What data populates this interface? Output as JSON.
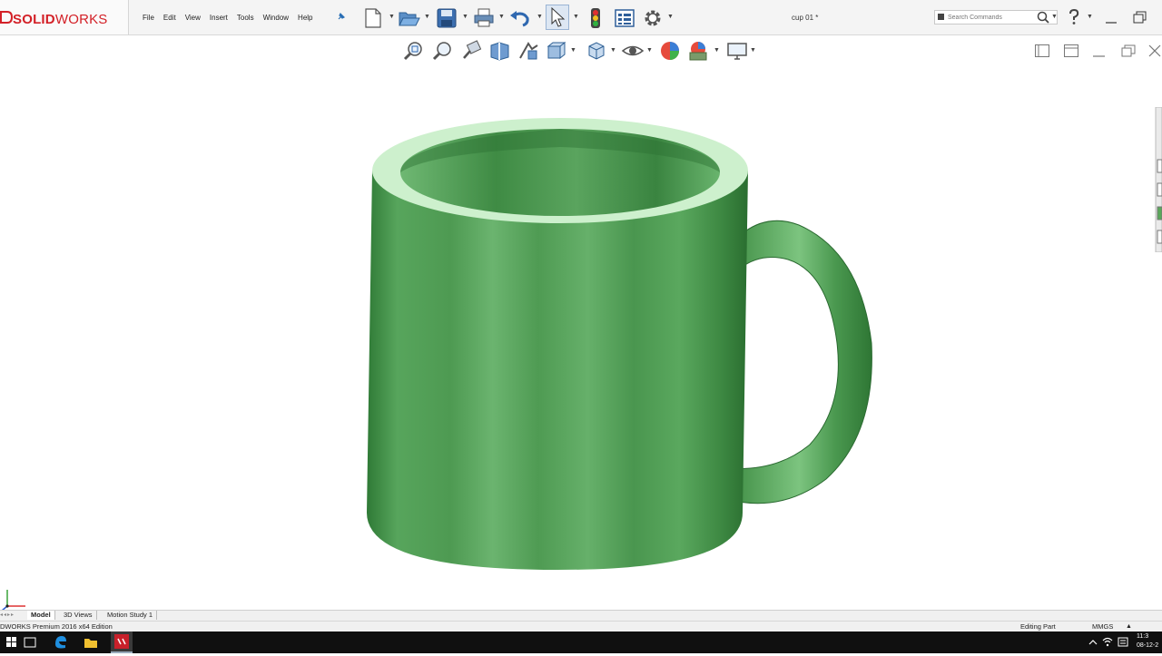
{
  "app": {
    "name_bold": "SOLID",
    "name_thin": "WORKS"
  },
  "menu": [
    "File",
    "Edit",
    "View",
    "Insert",
    "Tools",
    "Window",
    "Help"
  ],
  "document": {
    "title": "cup 01 *"
  },
  "search": {
    "placeholder": "Search Commands"
  },
  "icons": {
    "toolbar": [
      "new-document-icon",
      "open-folder-icon",
      "save-icon",
      "print-icon",
      "undo-icon",
      "select-pointer-icon",
      "rebuild-icon",
      "file-properties-icon",
      "options-gear-icon"
    ],
    "heads_up": [
      "zoom-to-fit-icon",
      "zoom-to-area-icon",
      "previous-view-icon",
      "section-view-icon",
      "view-orientation-dynamic-icon",
      "display-style-icon",
      "view-orientation-icon",
      "hide-show-icon",
      "edit-appearance-icon",
      "apply-scene-icon",
      "view-settings-icon"
    ]
  },
  "model": {
    "color": "#5aa85a",
    "rim_color": "#cdf0cd"
  },
  "tabs": [
    "Model",
    "3D Views",
    "Motion Study 1"
  ],
  "status": {
    "edition": "DWORKS Premium 2016 x64 Edition",
    "mode": "Editing Part",
    "units": "MMGS"
  },
  "taskbar": {
    "time": "11:3",
    "date": "08-12-2"
  }
}
